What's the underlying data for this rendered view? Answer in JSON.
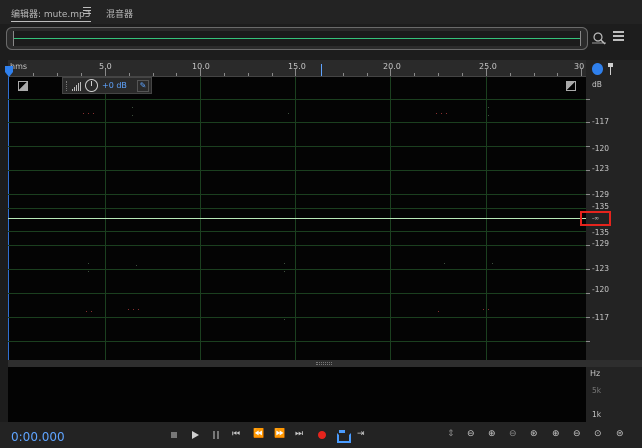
{
  "tabs": {
    "editor_label": "编辑器: mute.mp3",
    "mixer_label": "混音器"
  },
  "ruler": {
    "unit": "hms",
    "labels": [
      "5.0",
      "10.0",
      "15.0",
      "20.0",
      "25.0",
      "30"
    ]
  },
  "hud": {
    "gain": "+0 dB"
  },
  "db_scale": {
    "unit": "dB",
    "labels": [
      "-117",
      "-120",
      "-123",
      "-129",
      "-135",
      "-∞",
      "-135",
      "-129",
      "-123",
      "-120",
      "-117"
    ],
    "highlight_color": "#e5241d"
  },
  "spectral_scale": {
    "unit": "Hz",
    "labels": [
      "5k",
      "1k"
    ]
  },
  "transport": {
    "time": "0:00.000"
  },
  "colors": {
    "accent": "#5fa4ff",
    "grid": "#1b3f1f",
    "center_line": "#b8e7b8",
    "record": "#e5241d"
  },
  "icons": {
    "tab_menu": "hamburger-icon",
    "overview_zoom": "zoom-time-icon",
    "panel_list": "list-icon",
    "snap": "magnet-icon",
    "marker": "pin-icon"
  }
}
